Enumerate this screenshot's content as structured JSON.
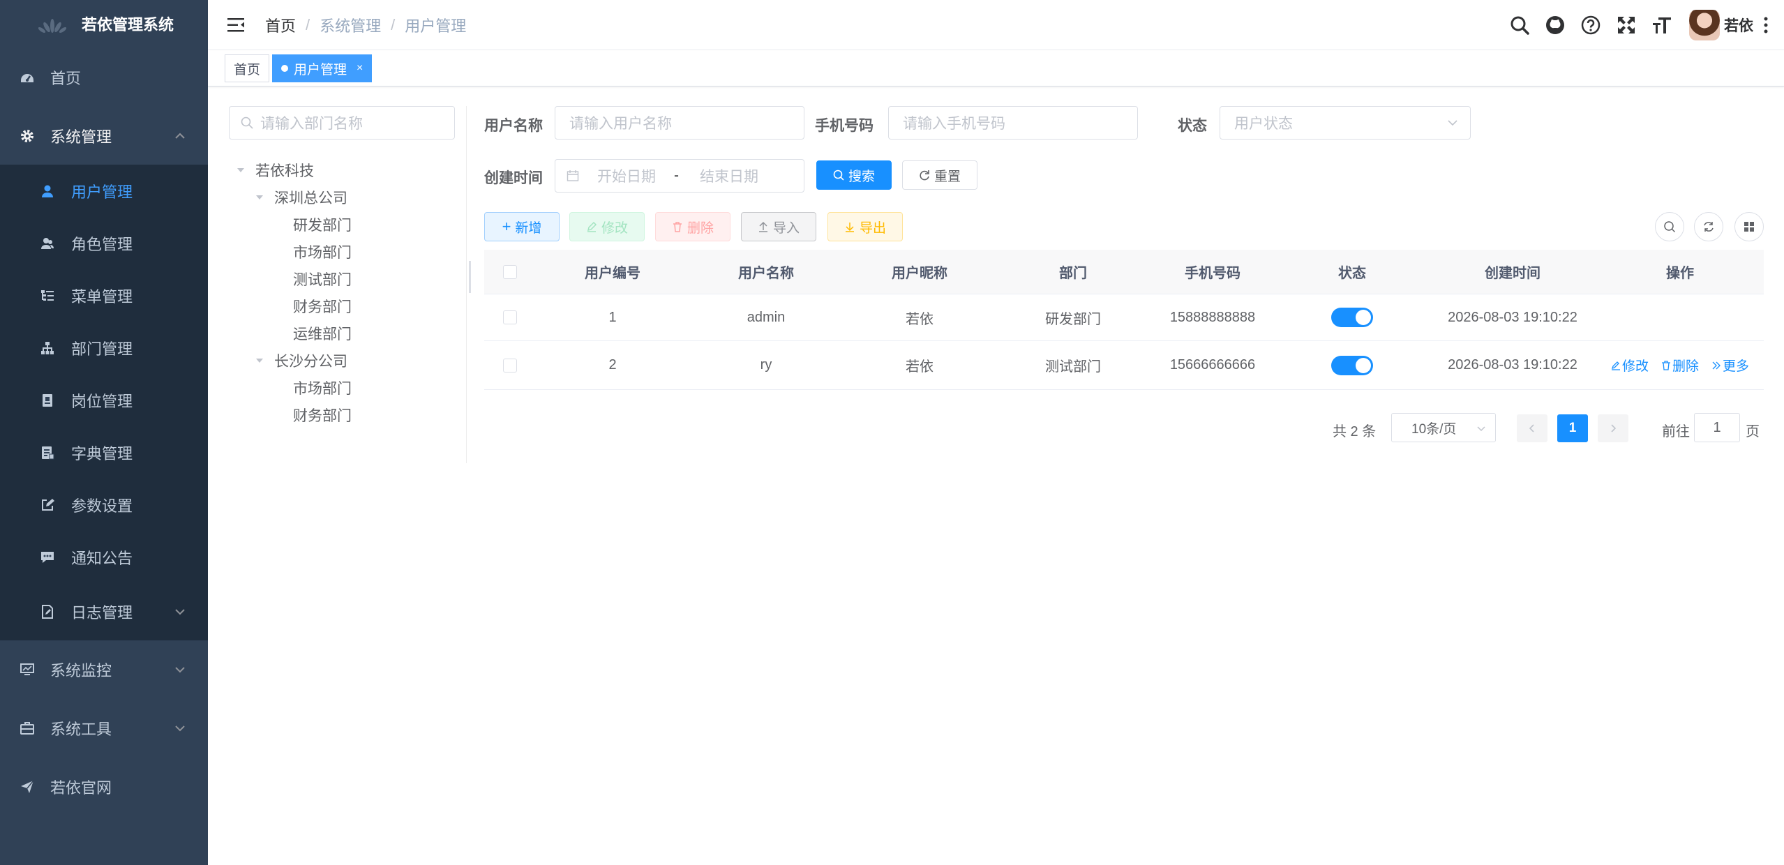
{
  "app": {
    "title": "若依管理系统"
  },
  "sidebar": {
    "items": [
      {
        "label": "首页",
        "icon": "dashboard-icon"
      },
      {
        "label": "系统管理",
        "icon": "gear-icon",
        "expanded": true,
        "children": [
          {
            "label": "用户管理",
            "icon": "user-icon",
            "active": true
          },
          {
            "label": "角色管理",
            "icon": "peoples-icon"
          },
          {
            "label": "菜单管理",
            "icon": "tree-table-icon"
          },
          {
            "label": "部门管理",
            "icon": "tree-icon"
          },
          {
            "label": "岗位管理",
            "icon": "post-icon"
          },
          {
            "label": "字典管理",
            "icon": "dict-icon"
          },
          {
            "label": "参数设置",
            "icon": "edit-icon"
          },
          {
            "label": "通知公告",
            "icon": "message-icon"
          },
          {
            "label": "日志管理",
            "icon": "log-icon"
          }
        ]
      },
      {
        "label": "系统监控",
        "icon": "monitor-icon"
      },
      {
        "label": "系统工具",
        "icon": "tool-icon"
      },
      {
        "label": "若依官网",
        "icon": "guide-icon"
      }
    ]
  },
  "navbar": {
    "breadcrumb": [
      "首页",
      "系统管理",
      "用户管理"
    ],
    "user_name": "若依"
  },
  "tags": {
    "items": [
      {
        "label": "首页",
        "active": false
      },
      {
        "label": "用户管理",
        "active": true
      }
    ],
    "close_glyph": "×"
  },
  "dept_tree": {
    "search_placeholder": "请输入部门名称",
    "nodes": [
      {
        "label": "若依科技",
        "level": 0,
        "expanded": true
      },
      {
        "label": "深圳总公司",
        "level": 1,
        "expanded": true
      },
      {
        "label": "研发部门",
        "level": 2
      },
      {
        "label": "市场部门",
        "level": 2
      },
      {
        "label": "测试部门",
        "level": 2
      },
      {
        "label": "财务部门",
        "level": 2
      },
      {
        "label": "运维部门",
        "level": 2
      },
      {
        "label": "长沙分公司",
        "level": 1,
        "expanded": true
      },
      {
        "label": "市场部门",
        "level": 2
      },
      {
        "label": "财务部门",
        "level": 2
      }
    ]
  },
  "search_form": {
    "username_label": "用户名称",
    "username_placeholder": "请输入用户名称",
    "phone_label": "手机号码",
    "phone_placeholder": "请输入手机号码",
    "status_label": "状态",
    "status_placeholder": "用户状态",
    "created_label": "创建时间",
    "start_placeholder": "开始日期",
    "range_separator": "-",
    "end_placeholder": "结束日期",
    "search_button": "搜索",
    "reset_button": "重置"
  },
  "toolbar": {
    "add": "新增",
    "edit": "修改",
    "delete": "删除",
    "import": "导入",
    "export": "导出"
  },
  "table": {
    "columns": [
      "用户编号",
      "用户名称",
      "用户昵称",
      "部门",
      "手机号码",
      "状态",
      "创建时间",
      "操作"
    ],
    "rows": [
      {
        "id": "1",
        "username": "admin",
        "nickname": "若依",
        "dept": "研发部门",
        "phone": "15888888888",
        "status": true,
        "created": "2026-08-03 19:10:22",
        "ops": []
      },
      {
        "id": "2",
        "username": "ry",
        "nickname": "若依",
        "dept": "测试部门",
        "phone": "15666666666",
        "status": true,
        "created": "2026-08-03 19:10:22",
        "ops": [
          "修改",
          "删除",
          "更多"
        ]
      }
    ]
  },
  "pagination": {
    "total_text": "共 2 条",
    "page_size": "10条/页",
    "current_page": "1",
    "goto_prefix": "前往",
    "goto_value": "1",
    "goto_suffix": "页"
  },
  "colors": {
    "sidebar_bg": "#304156",
    "submenu_bg": "#1f2d3d",
    "primary": "#1890ff",
    "active_menu": "#409eff"
  }
}
